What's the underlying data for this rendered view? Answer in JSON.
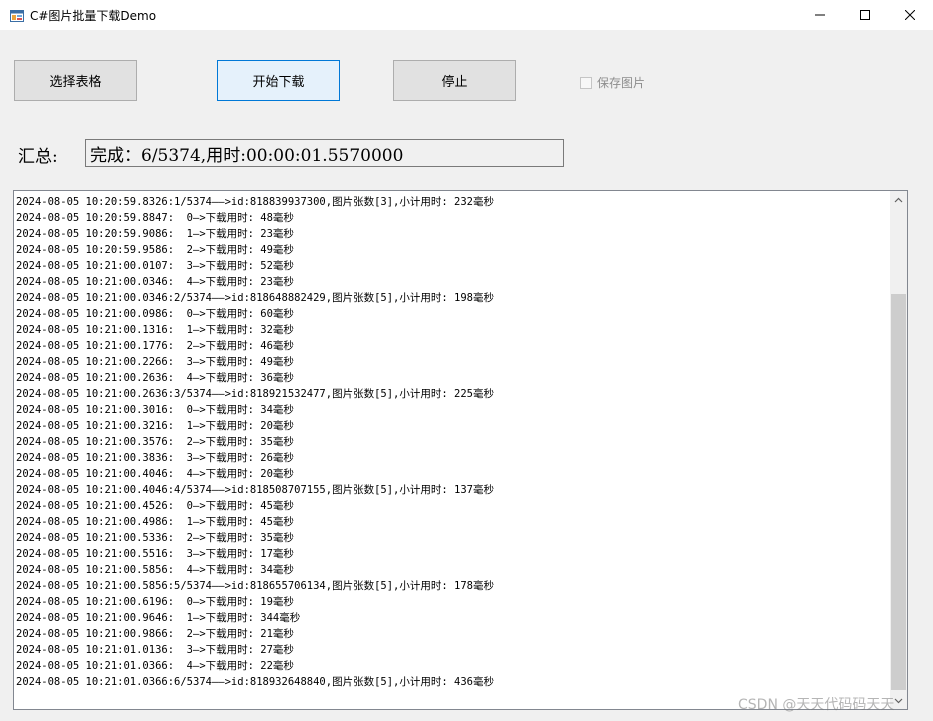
{
  "window": {
    "title": "C#图片批量下载Demo"
  },
  "toolbar": {
    "select_label": "选择表格",
    "start_label": "开始下载",
    "stop_label": "停止",
    "save_images_label": "保存图片",
    "save_images_checked": false
  },
  "summary": {
    "label": "汇总:",
    "value": "完成：6/5374,用时:00:00:01.5570000"
  },
  "log": {
    "lines": [
      "2024-08-05 10:20:59.8326:1/5374——>id:818839937300,图片张数[3],小计用时: 232毫秒",
      "2024-08-05 10:20:59.8847:  0—>下载用时: 48毫秒",
      "2024-08-05 10:20:59.9086:  1—>下载用时: 23毫秒",
      "2024-08-05 10:20:59.9586:  2—>下载用时: 49毫秒",
      "2024-08-05 10:21:00.0107:  3—>下载用时: 52毫秒",
      "2024-08-05 10:21:00.0346:  4—>下载用时: 23毫秒",
      "2024-08-05 10:21:00.0346:2/5374——>id:818648882429,图片张数[5],小计用时: 198毫秒",
      "2024-08-05 10:21:00.0986:  0—>下载用时: 60毫秒",
      "2024-08-05 10:21:00.1316:  1—>下载用时: 32毫秒",
      "2024-08-05 10:21:00.1776:  2—>下载用时: 46毫秒",
      "2024-08-05 10:21:00.2266:  3—>下载用时: 49毫秒",
      "2024-08-05 10:21:00.2636:  4—>下载用时: 36毫秒",
      "2024-08-05 10:21:00.2636:3/5374——>id:818921532477,图片张数[5],小计用时: 225毫秒",
      "2024-08-05 10:21:00.3016:  0—>下载用时: 34毫秒",
      "2024-08-05 10:21:00.3216:  1—>下载用时: 20毫秒",
      "2024-08-05 10:21:00.3576:  2—>下载用时: 35毫秒",
      "2024-08-05 10:21:00.3836:  3—>下载用时: 26毫秒",
      "2024-08-05 10:21:00.4046:  4—>下载用时: 20毫秒",
      "2024-08-05 10:21:00.4046:4/5374——>id:818508707155,图片张数[5],小计用时: 137毫秒",
      "2024-08-05 10:21:00.4526:  0—>下载用时: 45毫秒",
      "2024-08-05 10:21:00.4986:  1—>下载用时: 45毫秒",
      "2024-08-05 10:21:00.5336:  2—>下载用时: 35毫秒",
      "2024-08-05 10:21:00.5516:  3—>下载用时: 17毫秒",
      "2024-08-05 10:21:00.5856:  4—>下载用时: 34毫秒",
      "2024-08-05 10:21:00.5856:5/5374——>id:818655706134,图片张数[5],小计用时: 178毫秒",
      "2024-08-05 10:21:00.6196:  0—>下载用时: 19毫秒",
      "2024-08-05 10:21:00.9646:  1—>下载用时: 344毫秒",
      "2024-08-05 10:21:00.9866:  2—>下载用时: 21毫秒",
      "2024-08-05 10:21:01.0136:  3—>下载用时: 27毫秒",
      "2024-08-05 10:21:01.0366:  4—>下载用时: 22毫秒",
      "2024-08-05 10:21:01.0366:6/5374——>id:818932648840,图片张数[5],小计用时: 436毫秒"
    ]
  },
  "watermark": "CSDN @天天代码码天天",
  "icons": {
    "app": "app-window-icon",
    "minimize": "minimize-icon",
    "maximize": "maximize-icon",
    "close": "close-icon",
    "scroll_up": "chevron-up-icon",
    "scroll_down": "chevron-down-icon"
  },
  "colors": {
    "primary_button_border": "#0078d7",
    "primary_button_bg": "#e5f1fb",
    "button_bg": "#e1e1e1",
    "window_bg": "#f0f0f0"
  }
}
